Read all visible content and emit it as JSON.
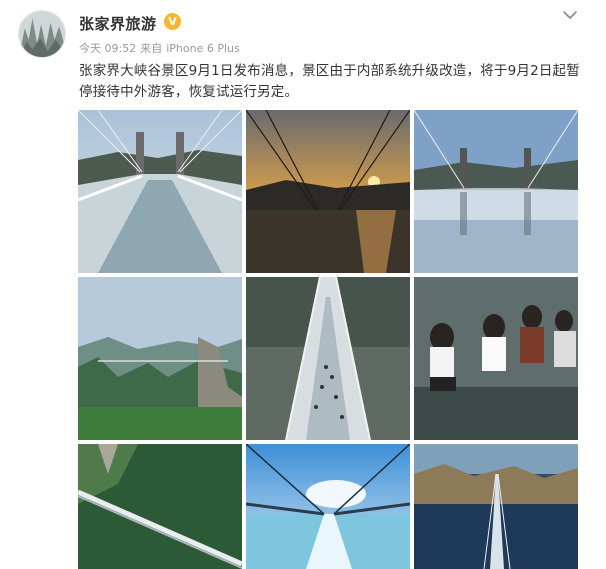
{
  "post": {
    "author": "张家界旅游",
    "verified_badge": "V",
    "time": "今天 09:52",
    "source_prefix": "来自",
    "device": "iPhone 6 Plus",
    "text": "张家界大峡谷景区9月1日发布消息，景区由于内部系统升级改造，将于9月2日起暂停接待中外游客，恢复试运行另定。",
    "icons": {
      "menu": "chevron-down-icon",
      "verified": "verified-v-icon"
    },
    "colors": {
      "verified": "#f7b731",
      "name": "#333333",
      "meta": "#9a9a9a"
    }
  }
}
